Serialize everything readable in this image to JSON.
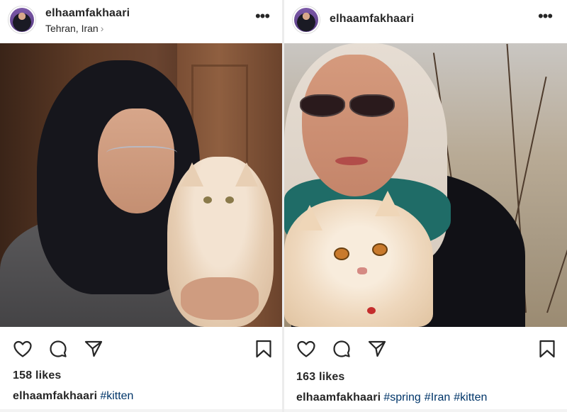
{
  "posts": [
    {
      "username": "elhaamfakhaari",
      "location": "Tehran, Iran",
      "likes": "158 likes",
      "caption_user": "elhaamfakhaari",
      "tags": [
        "#kitten"
      ]
    },
    {
      "username": "elhaamfakhaari",
      "location": "",
      "likes": "163 likes",
      "caption_user": "elhaamfakhaari",
      "tags": [
        "#spring",
        "#Iran",
        "#kitten"
      ]
    }
  ],
  "icons": {
    "like": "heart-icon",
    "comment": "comment-icon",
    "share": "share-icon",
    "save": "bookmark-icon",
    "more": "more-options-icon",
    "location_link": "chevron-right-icon"
  },
  "colors": {
    "text": "#262626",
    "hashtag": "#003569",
    "secondary": "#8e8e8e"
  }
}
